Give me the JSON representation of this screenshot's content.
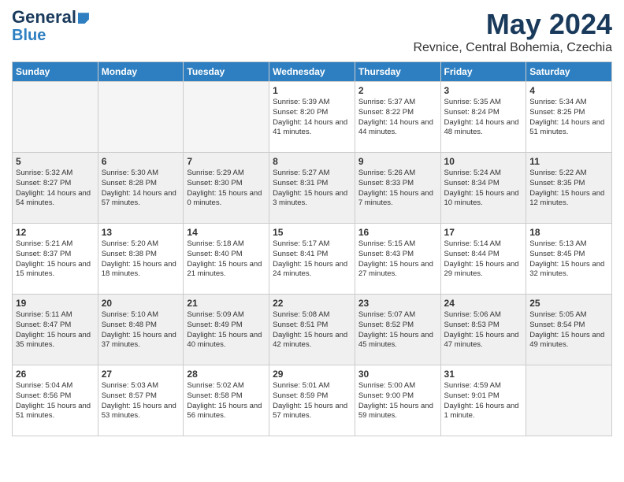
{
  "logo": {
    "line1": "General",
    "line2": "Blue"
  },
  "title": {
    "month_year": "May 2024",
    "location": "Revnice, Central Bohemia, Czechia"
  },
  "days_of_week": [
    "Sunday",
    "Monday",
    "Tuesday",
    "Wednesday",
    "Thursday",
    "Friday",
    "Saturday"
  ],
  "weeks": [
    [
      {
        "day": "",
        "empty": true
      },
      {
        "day": "",
        "empty": true
      },
      {
        "day": "",
        "empty": true
      },
      {
        "day": "1",
        "sunrise": "5:39 AM",
        "sunset": "8:20 PM",
        "daylight": "14 hours and 41 minutes."
      },
      {
        "day": "2",
        "sunrise": "5:37 AM",
        "sunset": "8:22 PM",
        "daylight": "14 hours and 44 minutes."
      },
      {
        "day": "3",
        "sunrise": "5:35 AM",
        "sunset": "8:24 PM",
        "daylight": "14 hours and 48 minutes."
      },
      {
        "day": "4",
        "sunrise": "5:34 AM",
        "sunset": "8:25 PM",
        "daylight": "14 hours and 51 minutes."
      }
    ],
    [
      {
        "day": "5",
        "sunrise": "5:32 AM",
        "sunset": "8:27 PM",
        "daylight": "14 hours and 54 minutes."
      },
      {
        "day": "6",
        "sunrise": "5:30 AM",
        "sunset": "8:28 PM",
        "daylight": "14 hours and 57 minutes."
      },
      {
        "day": "7",
        "sunrise": "5:29 AM",
        "sunset": "8:30 PM",
        "daylight": "15 hours and 0 minutes."
      },
      {
        "day": "8",
        "sunrise": "5:27 AM",
        "sunset": "8:31 PM",
        "daylight": "15 hours and 3 minutes."
      },
      {
        "day": "9",
        "sunrise": "5:26 AM",
        "sunset": "8:33 PM",
        "daylight": "15 hours and 7 minutes."
      },
      {
        "day": "10",
        "sunrise": "5:24 AM",
        "sunset": "8:34 PM",
        "daylight": "15 hours and 10 minutes."
      },
      {
        "day": "11",
        "sunrise": "5:22 AM",
        "sunset": "8:35 PM",
        "daylight": "15 hours and 12 minutes."
      }
    ],
    [
      {
        "day": "12",
        "sunrise": "5:21 AM",
        "sunset": "8:37 PM",
        "daylight": "15 hours and 15 minutes."
      },
      {
        "day": "13",
        "sunrise": "5:20 AM",
        "sunset": "8:38 PM",
        "daylight": "15 hours and 18 minutes."
      },
      {
        "day": "14",
        "sunrise": "5:18 AM",
        "sunset": "8:40 PM",
        "daylight": "15 hours and 21 minutes."
      },
      {
        "day": "15",
        "sunrise": "5:17 AM",
        "sunset": "8:41 PM",
        "daylight": "15 hours and 24 minutes."
      },
      {
        "day": "16",
        "sunrise": "5:15 AM",
        "sunset": "8:43 PM",
        "daylight": "15 hours and 27 minutes."
      },
      {
        "day": "17",
        "sunrise": "5:14 AM",
        "sunset": "8:44 PM",
        "daylight": "15 hours and 29 minutes."
      },
      {
        "day": "18",
        "sunrise": "5:13 AM",
        "sunset": "8:45 PM",
        "daylight": "15 hours and 32 minutes."
      }
    ],
    [
      {
        "day": "19",
        "sunrise": "5:11 AM",
        "sunset": "8:47 PM",
        "daylight": "15 hours and 35 minutes."
      },
      {
        "day": "20",
        "sunrise": "5:10 AM",
        "sunset": "8:48 PM",
        "daylight": "15 hours and 37 minutes."
      },
      {
        "day": "21",
        "sunrise": "5:09 AM",
        "sunset": "8:49 PM",
        "daylight": "15 hours and 40 minutes."
      },
      {
        "day": "22",
        "sunrise": "5:08 AM",
        "sunset": "8:51 PM",
        "daylight": "15 hours and 42 minutes."
      },
      {
        "day": "23",
        "sunrise": "5:07 AM",
        "sunset": "8:52 PM",
        "daylight": "15 hours and 45 minutes."
      },
      {
        "day": "24",
        "sunrise": "5:06 AM",
        "sunset": "8:53 PM",
        "daylight": "15 hours and 47 minutes."
      },
      {
        "day": "25",
        "sunrise": "5:05 AM",
        "sunset": "8:54 PM",
        "daylight": "15 hours and 49 minutes."
      }
    ],
    [
      {
        "day": "26",
        "sunrise": "5:04 AM",
        "sunset": "8:56 PM",
        "daylight": "15 hours and 51 minutes."
      },
      {
        "day": "27",
        "sunrise": "5:03 AM",
        "sunset": "8:57 PM",
        "daylight": "15 hours and 53 minutes."
      },
      {
        "day": "28",
        "sunrise": "5:02 AM",
        "sunset": "8:58 PM",
        "daylight": "15 hours and 56 minutes."
      },
      {
        "day": "29",
        "sunrise": "5:01 AM",
        "sunset": "8:59 PM",
        "daylight": "15 hours and 57 minutes."
      },
      {
        "day": "30",
        "sunrise": "5:00 AM",
        "sunset": "9:00 PM",
        "daylight": "15 hours and 59 minutes."
      },
      {
        "day": "31",
        "sunrise": "4:59 AM",
        "sunset": "9:01 PM",
        "daylight": "16 hours and 1 minute."
      },
      {
        "day": "",
        "empty": true
      }
    ]
  ]
}
